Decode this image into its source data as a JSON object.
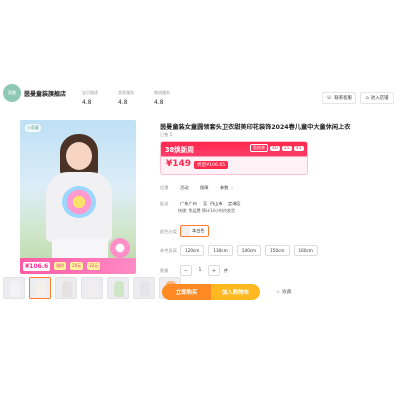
{
  "store": {
    "logo_text": "茵曼",
    "name": "茵曼童装旗舰店",
    "metrics": [
      {
        "label": "宝贝描述",
        "value": "4.8"
      },
      {
        "label": "卖家服务",
        "value": "4.8"
      },
      {
        "label": "物流服务",
        "value": "4.8"
      }
    ],
    "contact_label": "联系客服",
    "enter_label": "进入店铺"
  },
  "gallery": {
    "logo_text": "小茵童",
    "promo_price": "¥106.6",
    "promo_chips": [
      "限时",
      "20元",
      "22元"
    ]
  },
  "product": {
    "title": "茵曼童装女童圆领套头卫衣甜美印花装饰2024春儿童中大童休闲上衣",
    "sold": "已售 5",
    "event_name": "38焕新周",
    "countdown_label": "距结束",
    "countdown": [
      "40",
      "25",
      "45"
    ],
    "price": "¥149",
    "price_after": "折后¥106.65"
  },
  "options": {
    "promo_label": "优惠",
    "services": [
      "活动",
      "保障",
      "参数"
    ],
    "ship_label": "配送",
    "ship_from": "广东广州",
    "ship_to_label": "至",
    "ship_to": "丹山市",
    "ship_to2": "定海区",
    "ship_sub": "快递: 免运费   预计14小时内发货",
    "color_label": "颜色分类",
    "color_value": "本白色",
    "size_label": "参考身高",
    "sizes": [
      "120cm",
      "130cm",
      "140cm",
      "150cm",
      "160cm"
    ],
    "qty_label": "数量",
    "qty_value": "1",
    "qty_unit": "件"
  },
  "actions": {
    "buy": "立即购买",
    "cart": "加入购物车",
    "fav": "收藏"
  },
  "colors": {
    "accent": "#ff2a4e",
    "buy": "#ff8a24",
    "cart": "#ffb81f"
  }
}
